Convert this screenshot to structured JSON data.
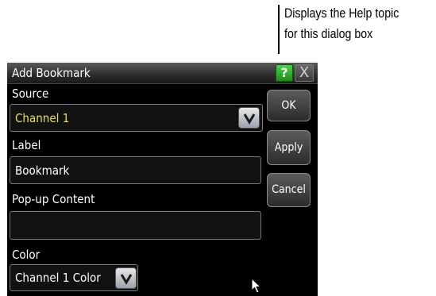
{
  "callout": {
    "line1": "Displays the Help topic",
    "line2": "for this dialog box"
  },
  "dialog": {
    "title": "Add Bookmark",
    "help_label": "?",
    "close_label": "X",
    "source": {
      "label": "Source",
      "value": "Channel 1"
    },
    "label_field": {
      "label": "Label",
      "value": "Bookmark"
    },
    "popup": {
      "label": "Pop-up Content",
      "value": ""
    },
    "color": {
      "label": "Color",
      "value": "Channel 1 Color"
    },
    "buttons": {
      "ok": "OK",
      "apply": "Apply",
      "cancel": "Cancel"
    }
  },
  "colors": {
    "source_value": "#e8e04a",
    "help_green": "#2aa826",
    "dialog_bg": "#000000"
  }
}
